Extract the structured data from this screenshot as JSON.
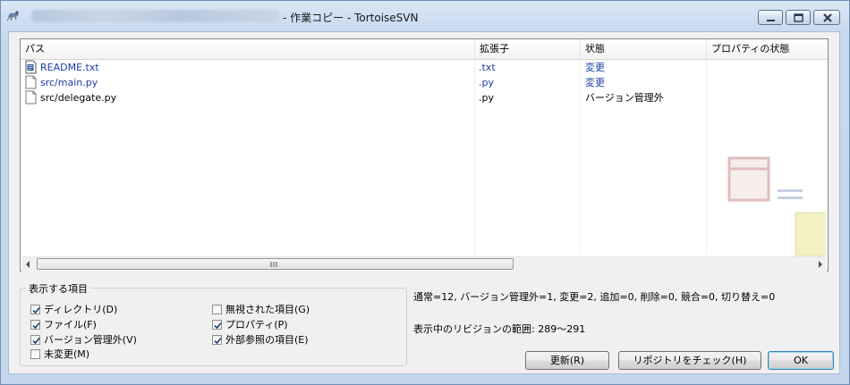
{
  "window": {
    "title": "- 作業コピー - TortoiseSVN"
  },
  "file_list": {
    "columns": [
      "パス",
      "拡張子",
      "状態",
      "プロパティの状態"
    ],
    "rows": [
      {
        "path": "README.txt",
        "extension": ".txt",
        "status": "変更",
        "property_status": "",
        "color": "#1a3ea8",
        "icon": "text-file-icon"
      },
      {
        "path": "src/main.py",
        "extension": ".py",
        "status": "変更",
        "property_status": "",
        "color": "#1a3ea8",
        "icon": "file-icon"
      },
      {
        "path": "src/delegate.py",
        "extension": ".py",
        "status": "バージョン管理外",
        "property_status": "",
        "color": "#000000",
        "icon": "file-icon"
      }
    ],
    "scrollbar_grip": "III"
  },
  "display_options": {
    "legend": "表示する項目",
    "items": [
      {
        "label": "ディレクトリ(D)",
        "checked": true
      },
      {
        "label": "ファイル(F)",
        "checked": true
      },
      {
        "label": "バージョン管理外(V)",
        "checked": true
      },
      {
        "label": "未変更(M)",
        "checked": false
      },
      {
        "label": "無視された項目(G)",
        "checked": false
      },
      {
        "label": "プロパティ(P)",
        "checked": true
      },
      {
        "label": "外部参照の項目(E)",
        "checked": true
      }
    ]
  },
  "summary": "通常=12, バージョン管理外=1, 変更=2, 追加=0, 削除=0, 競合=0, 切り替え=0",
  "revision_range": "表示中のリビジョンの範囲: 289〜291",
  "buttons": {
    "refresh": "更新(R)",
    "check_repository": "リポジトリをチェック(H)",
    "ok": "OK"
  },
  "colors": {
    "modified_text": "#1a3ea8",
    "title_bar": "#c6d8ee",
    "window_border": "#6f8fb3"
  }
}
